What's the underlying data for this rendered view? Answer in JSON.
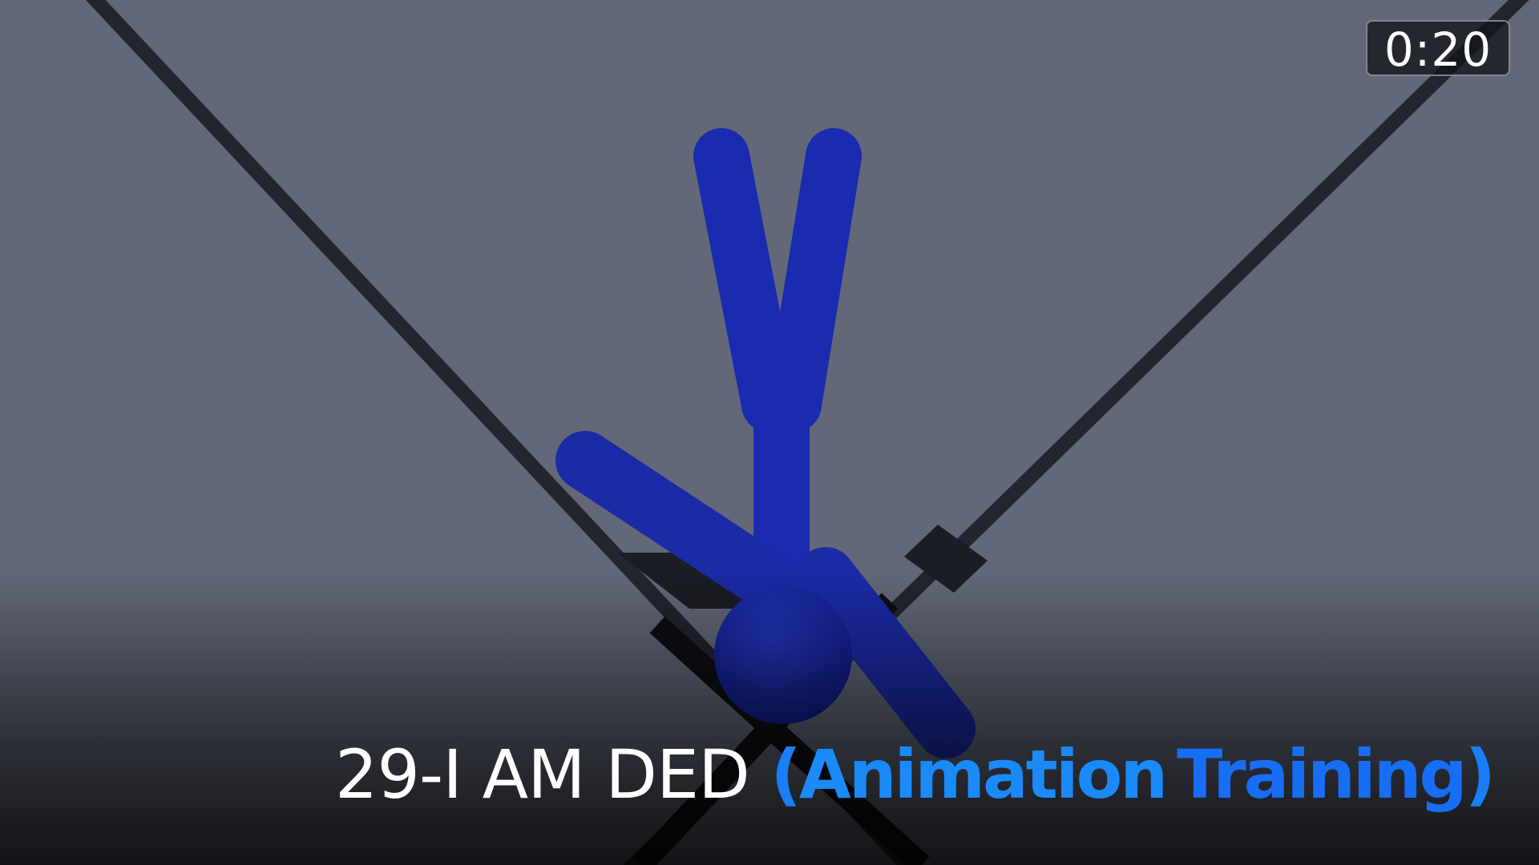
{
  "video": {
    "timestamp": "0:20",
    "caption": {
      "main": "29-I AM DED",
      "open_paren": "(",
      "word1": "Animation",
      "word2": "Training",
      "close_paren": ")"
    }
  },
  "colors": {
    "background": "#636878",
    "stick_figure": "#1a2bb0",
    "caption_accent_light": "#1a8af8",
    "caption_accent_dark": "#176ef5",
    "caption_main": "#ffffff"
  }
}
